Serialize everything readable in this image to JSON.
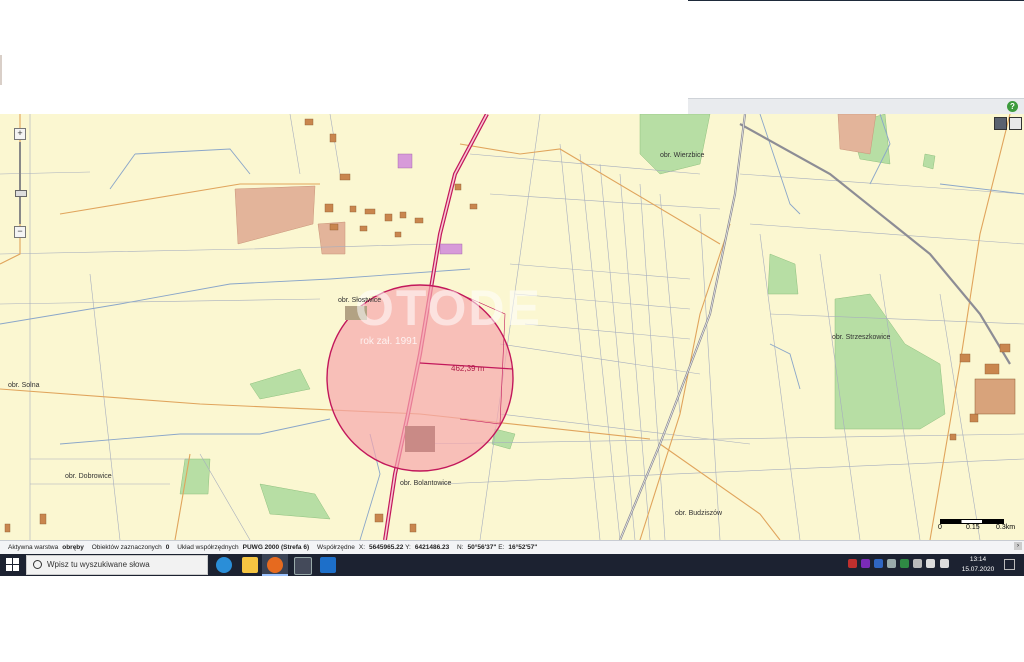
{
  "map": {
    "labels": {
      "wierzbice": "obr. Wierzbice",
      "slostwice": "obr. Słostwice",
      "solna": "obr. Solna",
      "dobrowice": "obr. Dobrowice",
      "bolantowice": "obr. Bolantowice",
      "budziszow": "obr. Budziszów",
      "stracza": "obr. Strzeszkowice"
    },
    "measure_label": "462,39 m",
    "watermark": "OTODE",
    "watermark_sub": "rok zał. 1991",
    "scale": {
      "t0": "0",
      "t1": "0.15",
      "t2": "0.3km"
    }
  },
  "status": {
    "layer_label": "Aktywna warstwa",
    "layer_value": "obręby",
    "selected_label": "Obiektów zaznaczonych",
    "selected_value": "0",
    "crs_label": "Układ współrzędnych",
    "crs_value": "PUWG 2000 (Strefa 6)",
    "coords_label": "Współrzędne",
    "x_label": "X:",
    "x_value": "5645965.22",
    "y_label": "Y:",
    "y_value": "6421486.23",
    "n_label": "N:",
    "n_value": "50°56'37\"",
    "e_label": "E:",
    "e_value": "16°52'57\""
  },
  "taskbar": {
    "search_placeholder": "Wpisz tu wyszukiwane słowa",
    "time": "13:14",
    "date": "15.07.2020"
  },
  "colors": {
    "map_bg": "#fbf7d1",
    "road": "#c2185b",
    "parcel_line": "#9aa3b3",
    "boundary": "#e0a45c",
    "forest": "#a9d79a",
    "building": "#c9864e",
    "circle_fill": "#f7a7ae",
    "taskbar": "#1c2231"
  }
}
